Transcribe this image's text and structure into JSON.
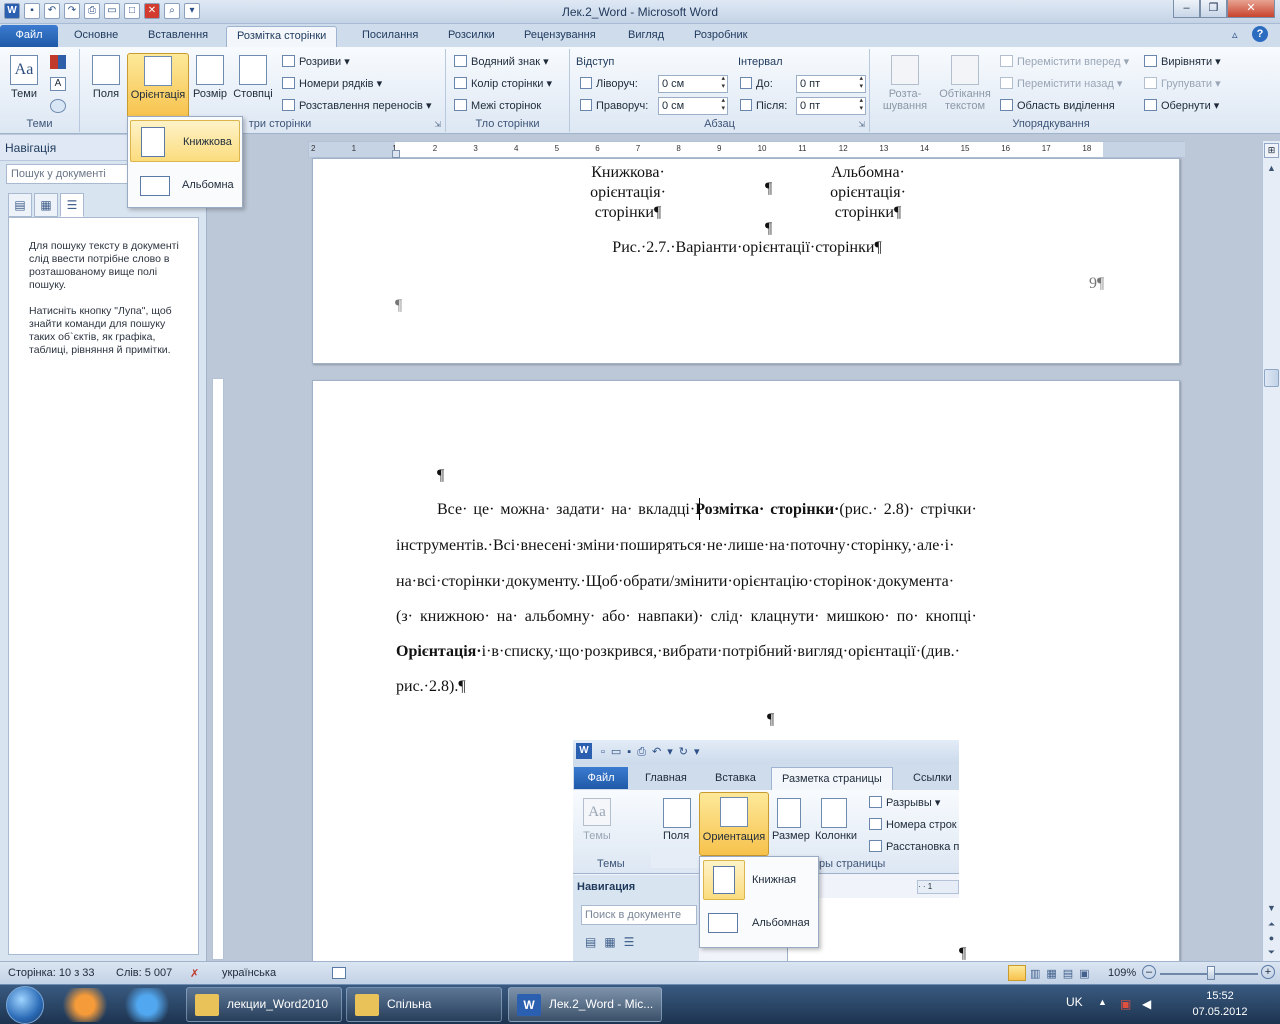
{
  "window": {
    "title": "Лек.2_Word  -  Microsoft Word"
  },
  "tabs": [
    "Файл",
    "Основне",
    "Вставлення",
    "Розмітка сторінки",
    "Посилання",
    "Розсилки",
    "Рецензування",
    "Вигляд",
    "Розробник"
  ],
  "ribbon": {
    "themes": {
      "btn": "Теми",
      "group": "Теми"
    },
    "page_setup": {
      "fields": "Поля",
      "orientation": "Орієнтація",
      "size": "Розмір",
      "columns": "Стовпці",
      "breaks": "Розриви",
      "line_numbers": "Номери рядків",
      "hyphenation": "Розставлення переносів",
      "group": "Параметри сторінки",
      "group_visible": "три сторінки"
    },
    "page_background": {
      "watermark": "Водяний знак",
      "page_color": "Колір сторінки",
      "page_borders": "Межі сторінок",
      "group": "Тло сторінки"
    },
    "paragraph": {
      "indent": "Відступ",
      "left": "Ліворуч:",
      "left_val": "0 см",
      "right": "Праворуч:",
      "right_val": "0 см",
      "spacing": "Інтервал",
      "before": "До:",
      "before_val": "0 пт",
      "after": "Після:",
      "after_val": "0 пт",
      "group": "Абзац"
    },
    "arrange": {
      "position_line1": "Розта-",
      "position_line2": "шування",
      "wrap_line1": "Обтікання",
      "wrap_line2": "текстом",
      "bring_forward": "Перемістити вперед",
      "send_backward": "Перемістити назад",
      "selection_pane": "Область виділення",
      "align": "Вирівняти",
      "group_objs": "Групувати",
      "rotate": "Обернути",
      "group": "Упорядкування"
    }
  },
  "orientation_menu": {
    "portrait": "Книжкова",
    "landscape": "Альбомна"
  },
  "nav": {
    "title": "Навігація",
    "search_placeholder": "Пошук у документі",
    "help1": "Для пошуку тексту в документі слід ввести потрібне слово в розташованому вище полі пошуку.",
    "help2": "Натисніть кнопку \"Лупа\", щоб знайти команди для пошуку таких об`єктів, як графіка, таблиці, рівняння й примітки."
  },
  "ruler_numbers": [
    "2",
    "1",
    "1",
    "2",
    "3",
    "4",
    "5",
    "6",
    "7",
    "8",
    "9",
    "10",
    "11",
    "12",
    "13",
    "14",
    "15",
    "16",
    "17",
    "18"
  ],
  "page1": {
    "left_cell": [
      "Книжкова·",
      "орієнтація·",
      "сторінки¶"
    ],
    "mid_marks": [
      "¶",
      "¶"
    ],
    "right_cell": [
      "Альбомна·",
      "орієнтація·",
      "сторінки¶"
    ],
    "caption": "Рис.·2.7.·Варіанти·орієнтації·сторінки¶",
    "page_number": "9¶",
    "empty_para": "¶"
  },
  "page2": {
    "empty_para": "¶",
    "line1_a": "Все· це· можна· задати· на· вкладці·",
    "line1_b": "Розмітка· сторінки·",
    "line1_c": "(рис.· 2.8)· стрічки·",
    "line2": "інструментів.·Всі·внесені·зміни·поширяться·не·лише·на·поточну·сторінку,·але·і·",
    "line3": "на·всі·сторінки·документу.·Щоб·обрати/змінити·орієнтацію·сторінок·документа·",
    "line4": "(з· книжною· на· альбомну· або· навпаки)· слід· клацнути· мишкою· по· кнопці·",
    "line5_a": "Орієнтація·",
    "line5_b": "і·в·списку,·що·розкрився,·вибрати·потрібний·вигляд·орієнтації·(див.·",
    "line6": "рис.·2.8).¶",
    "center_mark": "¶",
    "bottom_mark": "¶"
  },
  "figure": {
    "tabs": [
      "Файл",
      "Главная",
      "Вставка",
      "Разметка страницы",
      "Ссылки"
    ],
    "themes": "Темы",
    "themes_group": "Темы",
    "fields": "Поля",
    "orientation": "Ориентация",
    "size": "Размер",
    "columns": "Колонки",
    "breaks": "Разрывы",
    "line_numbers": "Номера строк",
    "hyphenation": "Расстановка п",
    "group_tail": "ры страницы",
    "nav_title": "Навигация",
    "nav_search": "Поиск в документе",
    "menu_portrait": "Книжная",
    "menu_landscape": "Альбомная"
  },
  "status": {
    "page": "Сторінка: 10 з 33",
    "words": "Слів: 5 007",
    "language": "українська",
    "zoom": "109%"
  },
  "taskbar": {
    "task1": "лекции_Word2010",
    "task2": "Спільна",
    "task3": "Лек.2_Word - Mic...",
    "lang": "UK",
    "time": "15:52",
    "date": "07.05.2012"
  }
}
